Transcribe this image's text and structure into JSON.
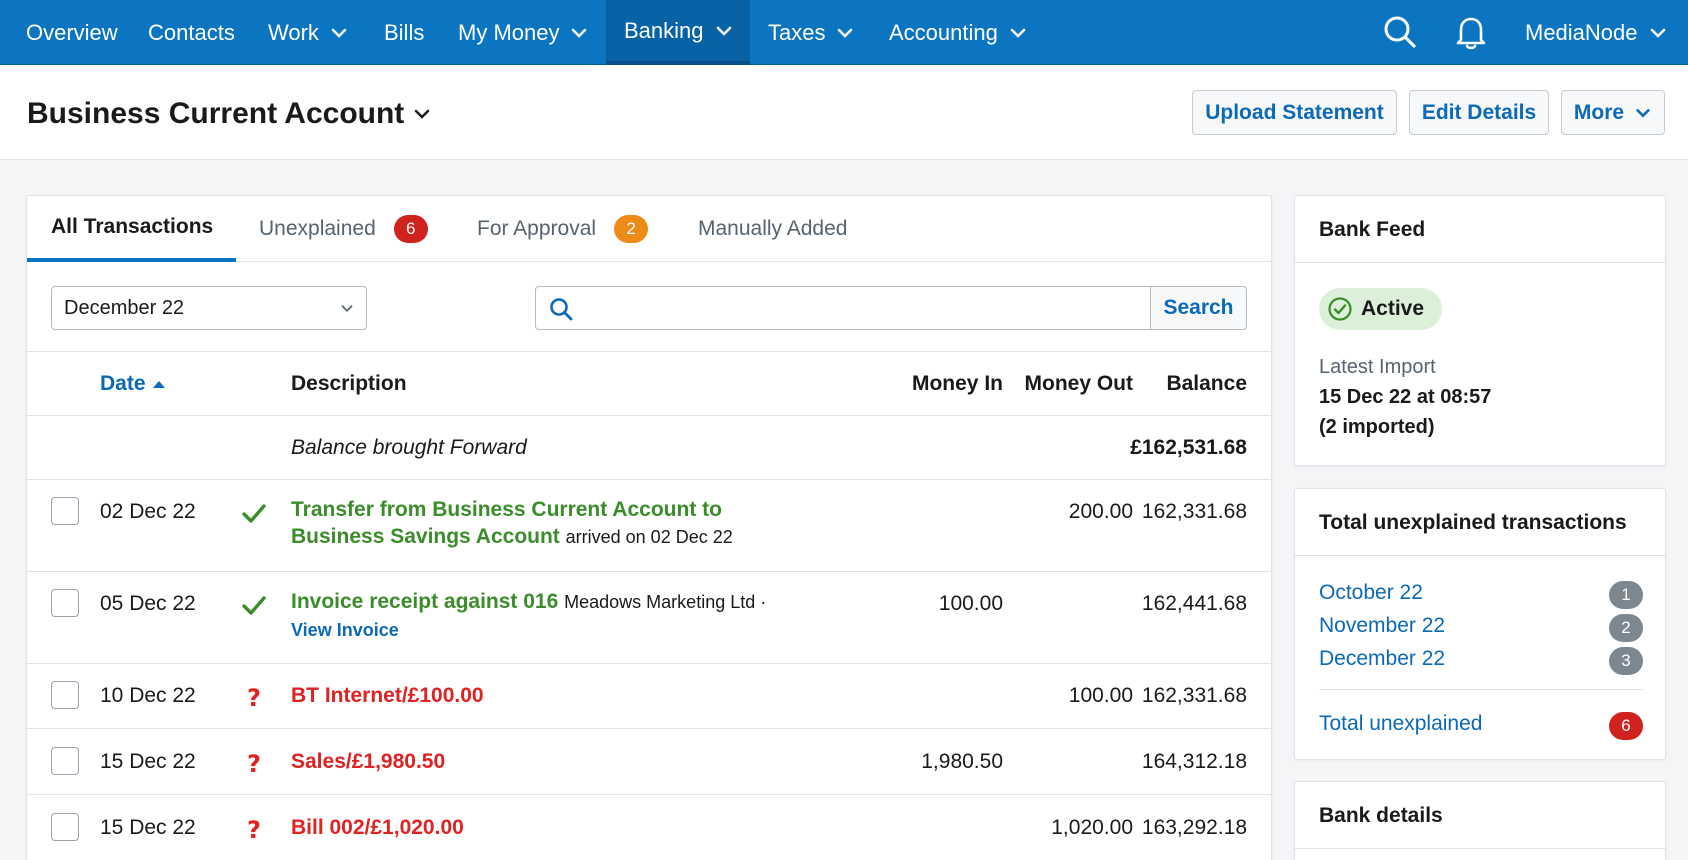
{
  "nav": {
    "items": [
      {
        "label": "Overview",
        "dropdown": false
      },
      {
        "label": "Contacts",
        "dropdown": false
      },
      {
        "label": "Work",
        "dropdown": true
      },
      {
        "label": "Bills",
        "dropdown": false
      },
      {
        "label": "My Money",
        "dropdown": true
      },
      {
        "label": "Banking",
        "dropdown": true,
        "active": true
      },
      {
        "label": "Taxes",
        "dropdown": true
      },
      {
        "label": "Accounting",
        "dropdown": true
      }
    ],
    "search_icon": "search-icon",
    "bell_icon": "bell-icon",
    "account_label": "MediaNode"
  },
  "header": {
    "title": "Business Current Account",
    "buttons": {
      "upload": "Upload Statement",
      "edit": "Edit Details",
      "more": "More"
    }
  },
  "tabs": [
    {
      "label": "All Transactions",
      "active": true
    },
    {
      "label": "Unexplained",
      "badge": "6",
      "badge_color": "#d0231f"
    },
    {
      "label": "For Approval",
      "badge": "2",
      "badge_color": "#ee8b18"
    },
    {
      "label": "Manually Added"
    }
  ],
  "filters": {
    "period": "December 22",
    "search_placeholder": "",
    "search_button": "Search"
  },
  "table": {
    "columns": {
      "date": "Date",
      "description": "Description",
      "money_in": "Money In",
      "money_out": "Money Out",
      "balance": "Balance"
    },
    "brought_forward": {
      "label": "Balance brought Forward",
      "balance": "£162,531.68"
    },
    "rows": [
      {
        "date": "02 Dec 22",
        "status": "explained",
        "title": "Transfer from Business Current Account to Business Savings Account",
        "suffix": "arrived on 02 Dec 22",
        "money_in": "",
        "money_out": "200.00",
        "balance": "162,331.68"
      },
      {
        "date": "05 Dec 22",
        "status": "explained",
        "title": "Invoice receipt against 016",
        "suffix": "Meadows Marketing Ltd ·",
        "link": "View Invoice",
        "money_in": "100.00",
        "money_out": "",
        "balance": "162,441.68"
      },
      {
        "date": "10 Dec 22",
        "status": "unexplained",
        "title": "BT Internet/£100.00",
        "money_in": "",
        "money_out": "100.00",
        "balance": "162,331.68"
      },
      {
        "date": "15 Dec 22",
        "status": "unexplained",
        "title": "Sales/£1,980.50",
        "money_in": "1,980.50",
        "money_out": "",
        "balance": "164,312.18"
      },
      {
        "date": "15 Dec 22",
        "status": "unexplained",
        "title": "Bill 002/£1,020.00",
        "money_in": "",
        "money_out": "1,020.00",
        "balance": "163,292.18"
      }
    ]
  },
  "bank_feed": {
    "title": "Bank Feed",
    "status": "Active",
    "latest_label": "Latest Import",
    "latest_date": "15 Dec 22 at 08:57",
    "latest_count": "(2 imported)"
  },
  "unexplained": {
    "title": "Total unexplained transactions",
    "items": [
      {
        "label": "October 22",
        "count": "1"
      },
      {
        "label": "November 22",
        "count": "2"
      },
      {
        "label": "December 22",
        "count": "3"
      }
    ],
    "total_label": "Total unexplained",
    "total_count": "6"
  },
  "bank_details": {
    "title": "Bank details"
  },
  "colors": {
    "brand": "#0b75c1",
    "link": "#0b69b7",
    "explained": "#3a8d2a",
    "unexplained": "#df2222",
    "active_green": "#dcefd8"
  }
}
